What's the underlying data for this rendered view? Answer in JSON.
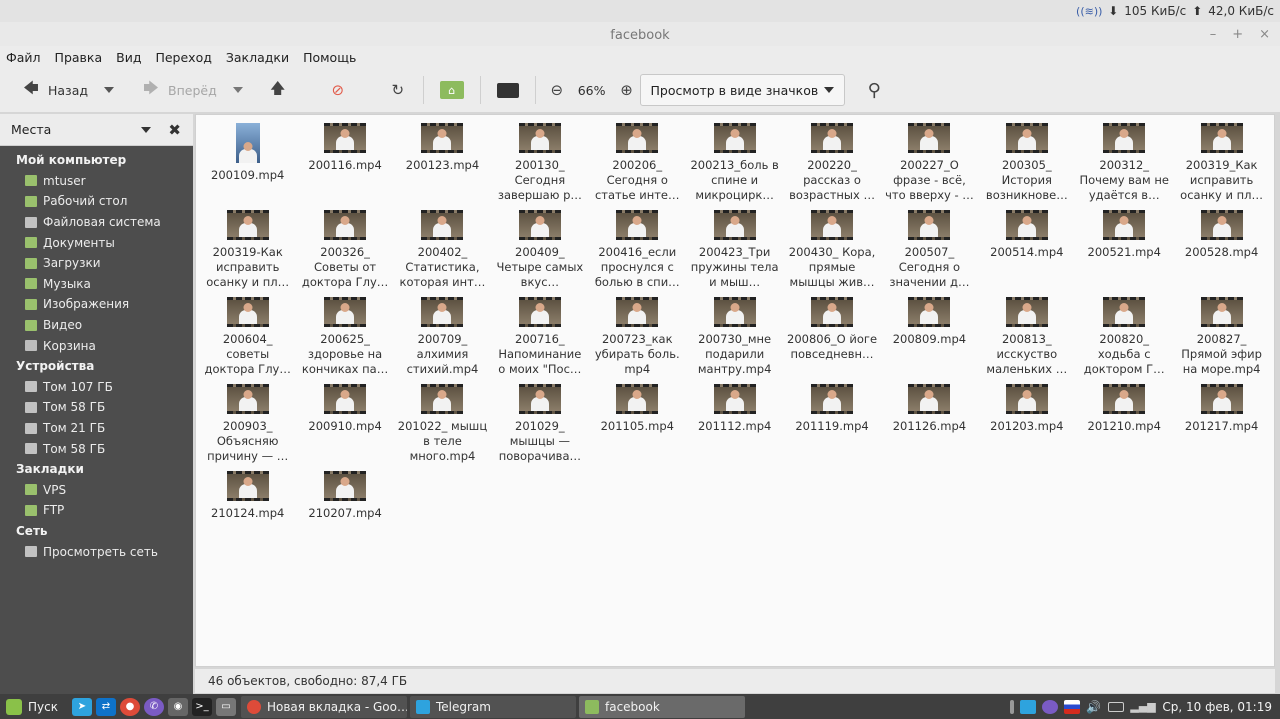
{
  "system_bar": {
    "download_speed": "105 КиБ/с",
    "upload_speed": "42,0 КиБ/с"
  },
  "window": {
    "title": "facebook",
    "controls": [
      "–",
      "+",
      "×"
    ]
  },
  "menu": [
    "Файл",
    "Правка",
    "Вид",
    "Переход",
    "Закладки",
    "Помощь"
  ],
  "toolbar": {
    "back_label": "Назад",
    "forward_label": "Вперёд",
    "zoom_level": "66%",
    "view_mode": "Просмотр в виде значков"
  },
  "sidebar": {
    "header": "Места",
    "sections": [
      {
        "title": "Мой компьютер",
        "items": [
          {
            "label": "mtuser",
            "icon": "folder-icon"
          },
          {
            "label": "Рабочий стол",
            "icon": "desktop-folder-icon"
          },
          {
            "label": "Файловая система",
            "icon": "drive-icon"
          },
          {
            "label": "Документы",
            "icon": "folder-icon"
          },
          {
            "label": "Загрузки",
            "icon": "folder-icon"
          },
          {
            "label": "Музыка",
            "icon": "folder-icon"
          },
          {
            "label": "Изображения",
            "icon": "folder-icon"
          },
          {
            "label": "Видео",
            "icon": "folder-icon"
          },
          {
            "label": "Корзина",
            "icon": "trash-icon"
          }
        ]
      },
      {
        "title": "Устройства",
        "items": [
          {
            "label": "Том 107 ГБ",
            "icon": "drive-icon"
          },
          {
            "label": "Том 58 ГБ",
            "icon": "drive-icon"
          },
          {
            "label": "Том 21 ГБ",
            "icon": "drive-icon"
          },
          {
            "label": "Том 58 ГБ",
            "icon": "drive-icon"
          }
        ]
      },
      {
        "title": "Закладки",
        "items": [
          {
            "label": "VPS",
            "icon": "folder-icon"
          },
          {
            "label": "FTP",
            "icon": "folder-icon"
          }
        ]
      },
      {
        "title": "Сеть",
        "items": [
          {
            "label": "Просмотреть сеть",
            "icon": "network-icon"
          }
        ]
      }
    ]
  },
  "files": [
    "200109.mp4",
    "200116.mp4",
    "200123.mp4",
    "200130_ Сегодня завершаю р…",
    "200206_ Сегодня о статье инте…",
    "200213_боль в спине и микроцирк…",
    "200220_ рассказ о возрастных …",
    "200227_О фразе - всё, что вверху - …",
    "200305_ История возникнове…",
    "200312_ Почему вам не удаётся в…",
    "200319_Как исправить осанку и пл…",
    "200319-Как исправить осанку и пл…",
    "200326_ Советы от доктора Глу…",
    "200402_ Статистика, которая инт…",
    "200409_ Четыре самых вкус…",
    "200416_если проснулся с болью в спи…",
    "200423_Три пружины тела и мыш…",
    "200430_ Кора, прямые мышцы жив…",
    "200507_ Сегодня о значении д…",
    "200514.mp4",
    "200521.mp4",
    "200528.mp4",
    "200604_ советы доктора Глу…",
    "200625_ здоровье на кончиках па…",
    "200709_ алхимия стихий.mp4",
    "200716_ Напоминание о моих \"Пос…",
    "200723_как убирать боль. mp4",
    "200730_мне подарили мантру.mp4",
    "200806_О йоге повседневн…",
    "200809.mp4",
    "200813_ исскуство маленьких …",
    "200820_ ходьба с доктором Г…",
    "200827_ Прямой эфир на море.mp4",
    "200903_ Объясняю причину — …",
    "200910.mp4",
    "201022_ мышц в теле много.mp4",
    "201029_ мышцы — поворачива…",
    "201105.mp4",
    "201112.mp4",
    "201119.mp4",
    "201126.mp4",
    "201203.mp4",
    "201210.mp4",
    "201217.mp4",
    "210124.mp4",
    "210207.mp4"
  ],
  "status": "46 объектов, свободно: 87,4 ГБ",
  "taskbar": {
    "start_label": "Пуск",
    "tasks": [
      {
        "label": "Новая вкладка - Goo…",
        "icon": "chrome-icon"
      },
      {
        "label": "Telegram",
        "icon": "telegram-icon"
      },
      {
        "label": "facebook",
        "icon": "folder-icon"
      }
    ],
    "clock": "Ср, 10 фев, 01:19"
  }
}
